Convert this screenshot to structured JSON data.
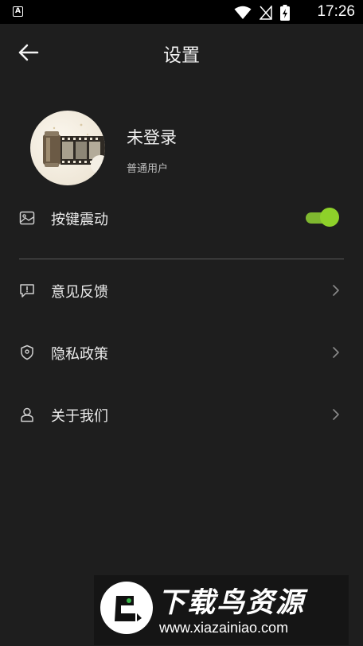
{
  "status_bar": {
    "app_icon_letter": "A",
    "time": "17:26"
  },
  "header": {
    "title": "设置"
  },
  "profile": {
    "username": "未登录",
    "user_type": "普通用户"
  },
  "settings": {
    "vibration": {
      "label": "按键震动",
      "enabled": true,
      "icon": "image-icon"
    },
    "items": [
      {
        "label": "意见反馈",
        "icon": "feedback-icon"
      },
      {
        "label": "隐私政策",
        "icon": "location-shield-icon"
      },
      {
        "label": "关于我们",
        "icon": "user-icon"
      }
    ]
  },
  "watermark": {
    "brand": "下载鸟资源",
    "url": "www.xiazainiao.com"
  },
  "colors": {
    "background": "#1e1e1e",
    "toggle_on": "#8ed12a"
  }
}
